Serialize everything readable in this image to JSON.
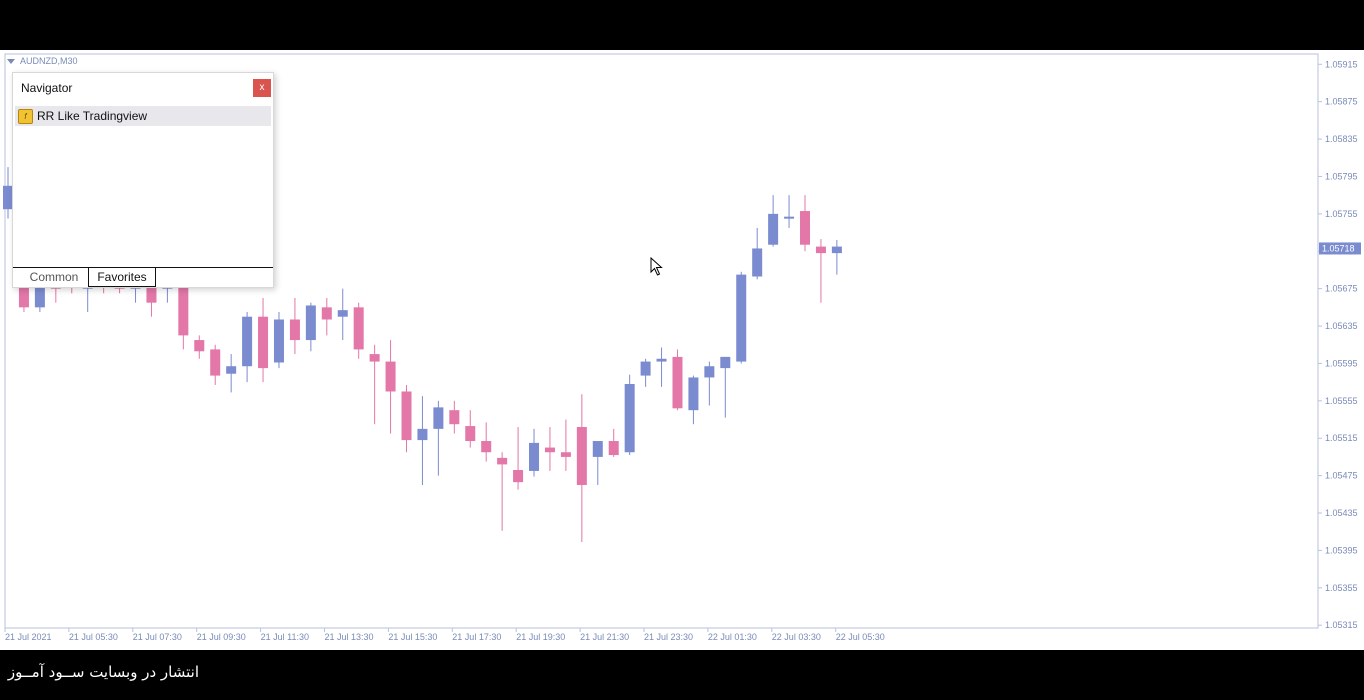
{
  "chart_window": {
    "title": "AUDNZD,M30",
    "current_price_label": "1.05718"
  },
  "navigator": {
    "title": "Navigator",
    "close_label": "x",
    "items": [
      {
        "label": "RR Like Tradingview",
        "icon": "indicator-icon"
      }
    ],
    "tabs": [
      {
        "label": "Common"
      },
      {
        "label": "Favorites",
        "active": true
      }
    ]
  },
  "footer": {
    "text": "انتشار در وبسایت ســود آمــوز"
  },
  "colors": {
    "bull": "#7b8bd0",
    "bear": "#e277a8",
    "axis_text": "#7a8ab8",
    "price_label_bg": "#7b8bd0",
    "close_button": "#d9534f"
  },
  "chart_data": {
    "type": "candlestick",
    "symbol": "AUDNZD",
    "timeframe": "M30",
    "y_ticks": [
      "1.05915",
      "1.05875",
      "1.05835",
      "1.05795",
      "1.05755",
      "1.05715",
      "1.05675",
      "1.05635",
      "1.05595",
      "1.05555",
      "1.05515",
      "1.05475",
      "1.05435",
      "1.05395",
      "1.05355",
      "1.05315"
    ],
    "ylim": [
      1.05312,
      1.05926
    ],
    "x_labels": [
      "21 Jul 2021",
      "21 Jul 05:30",
      "21 Jul 07:30",
      "21 Jul 09:30",
      "21 Jul 11:30",
      "21 Jul 13:30",
      "21 Jul 15:30",
      "21 Jul 17:30",
      "21 Jul 19:30",
      "21 Jul 21:30",
      "21 Jul 23:30",
      "22 Jul 01:30",
      "22 Jul 03:30",
      "22 Jul 05:30"
    ],
    "current_price": 1.05718,
    "candles": [
      {
        "o": 1.0576,
        "h": 1.05805,
        "l": 1.0575,
        "c": 1.05785
      },
      {
        "o": 1.05685,
        "h": 1.057,
        "l": 1.0565,
        "c": 1.05655
      },
      {
        "o": 1.05655,
        "h": 1.05705,
        "l": 1.0565,
        "c": 1.0569
      },
      {
        "o": 1.0569,
        "h": 1.057,
        "l": 1.0566,
        "c": 1.05675
      },
      {
        "o": 1.0569,
        "h": 1.057,
        "l": 1.0567,
        "c": 1.05685
      },
      {
        "o": 1.05675,
        "h": 1.057,
        "l": 1.0565,
        "c": 1.05688
      },
      {
        "o": 1.0569,
        "h": 1.057,
        "l": 1.0567,
        "c": 1.05688
      },
      {
        "o": 1.0569,
        "h": 1.057,
        "l": 1.0567,
        "c": 1.05675
      },
      {
        "o": 1.05675,
        "h": 1.057,
        "l": 1.0566,
        "c": 1.05685
      },
      {
        "o": 1.0568,
        "h": 1.05695,
        "l": 1.05645,
        "c": 1.0566
      },
      {
        "o": 1.05675,
        "h": 1.057,
        "l": 1.0566,
        "c": 1.0569
      },
      {
        "o": 1.0569,
        "h": 1.057,
        "l": 1.0561,
        "c": 1.05625
      },
      {
        "o": 1.0562,
        "h": 1.05625,
        "l": 1.056,
        "c": 1.05608
      },
      {
        "o": 1.0561,
        "h": 1.05615,
        "l": 1.05572,
        "c": 1.05582
      },
      {
        "o": 1.05584,
        "h": 1.05605,
        "l": 1.05564,
        "c": 1.05592
      },
      {
        "o": 1.05592,
        "h": 1.0565,
        "l": 1.05575,
        "c": 1.05645
      },
      {
        "o": 1.05645,
        "h": 1.05665,
        "l": 1.05575,
        "c": 1.0559
      },
      {
        "o": 1.05596,
        "h": 1.0565,
        "l": 1.0559,
        "c": 1.05642
      },
      {
        "o": 1.05642,
        "h": 1.05665,
        "l": 1.05605,
        "c": 1.0562
      },
      {
        "o": 1.0562,
        "h": 1.0566,
        "l": 1.05608,
        "c": 1.05657
      },
      {
        "o": 1.05655,
        "h": 1.05665,
        "l": 1.05625,
        "c": 1.05642
      },
      {
        "o": 1.05645,
        "h": 1.05675,
        "l": 1.0562,
        "c": 1.05652
      },
      {
        "o": 1.05655,
        "h": 1.0566,
        "l": 1.056,
        "c": 1.0561
      },
      {
        "o": 1.05605,
        "h": 1.05615,
        "l": 1.0553,
        "c": 1.05597
      },
      {
        "o": 1.05597,
        "h": 1.0562,
        "l": 1.0552,
        "c": 1.05565
      },
      {
        "o": 1.05565,
        "h": 1.05572,
        "l": 1.055,
        "c": 1.05513
      },
      {
        "o": 1.05513,
        "h": 1.0556,
        "l": 1.05465,
        "c": 1.05525
      },
      {
        "o": 1.05525,
        "h": 1.05555,
        "l": 1.05475,
        "c": 1.05548
      },
      {
        "o": 1.05545,
        "h": 1.05555,
        "l": 1.0552,
        "c": 1.0553
      },
      {
        "o": 1.05528,
        "h": 1.05545,
        "l": 1.05505,
        "c": 1.05512
      },
      {
        "o": 1.05512,
        "h": 1.05532,
        "l": 1.0549,
        "c": 1.055
      },
      {
        "o": 1.05494,
        "h": 1.055,
        "l": 1.05416,
        "c": 1.05487
      },
      {
        "o": 1.05481,
        "h": 1.05527,
        "l": 1.0546,
        "c": 1.05468
      },
      {
        "o": 1.0548,
        "h": 1.05525,
        "l": 1.05474,
        "c": 1.0551
      },
      {
        "o": 1.05505,
        "h": 1.05527,
        "l": 1.0548,
        "c": 1.055
      },
      {
        "o": 1.055,
        "h": 1.05535,
        "l": 1.0548,
        "c": 1.05495
      },
      {
        "o": 1.05527,
        "h": 1.05562,
        "l": 1.05404,
        "c": 1.05465
      },
      {
        "o": 1.05495,
        "h": 1.0551,
        "l": 1.05465,
        "c": 1.05512
      },
      {
        "o": 1.05512,
        "h": 1.05525,
        "l": 1.05495,
        "c": 1.05497
      },
      {
        "o": 1.055,
        "h": 1.05583,
        "l": 1.05497,
        "c": 1.05573
      },
      {
        "o": 1.05582,
        "h": 1.056,
        "l": 1.0557,
        "c": 1.05597
      },
      {
        "o": 1.05597,
        "h": 1.05612,
        "l": 1.0557,
        "c": 1.056
      },
      {
        "o": 1.05602,
        "h": 1.0561,
        "l": 1.05545,
        "c": 1.05547
      },
      {
        "o": 1.05545,
        "h": 1.05582,
        "l": 1.0553,
        "c": 1.0558
      },
      {
        "o": 1.0558,
        "h": 1.05597,
        "l": 1.0555,
        "c": 1.05592
      },
      {
        "o": 1.0559,
        "h": 1.05602,
        "l": 1.05537,
        "c": 1.05602
      },
      {
        "o": 1.05597,
        "h": 1.05693,
        "l": 1.05595,
        "c": 1.0569
      },
      {
        "o": 1.05688,
        "h": 1.0574,
        "l": 1.05685,
        "c": 1.05718
      },
      {
        "o": 1.05722,
        "h": 1.05775,
        "l": 1.0572,
        "c": 1.05755
      },
      {
        "o": 1.0575,
        "h": 1.05775,
        "l": 1.0574,
        "c": 1.05752
      },
      {
        "o": 1.05758,
        "h": 1.05775,
        "l": 1.05715,
        "c": 1.05722
      },
      {
        "o": 1.0572,
        "h": 1.05728,
        "l": 1.0566,
        "c": 1.05713
      },
      {
        "o": 1.05713,
        "h": 1.05727,
        "l": 1.0569,
        "c": 1.0572
      }
    ]
  }
}
